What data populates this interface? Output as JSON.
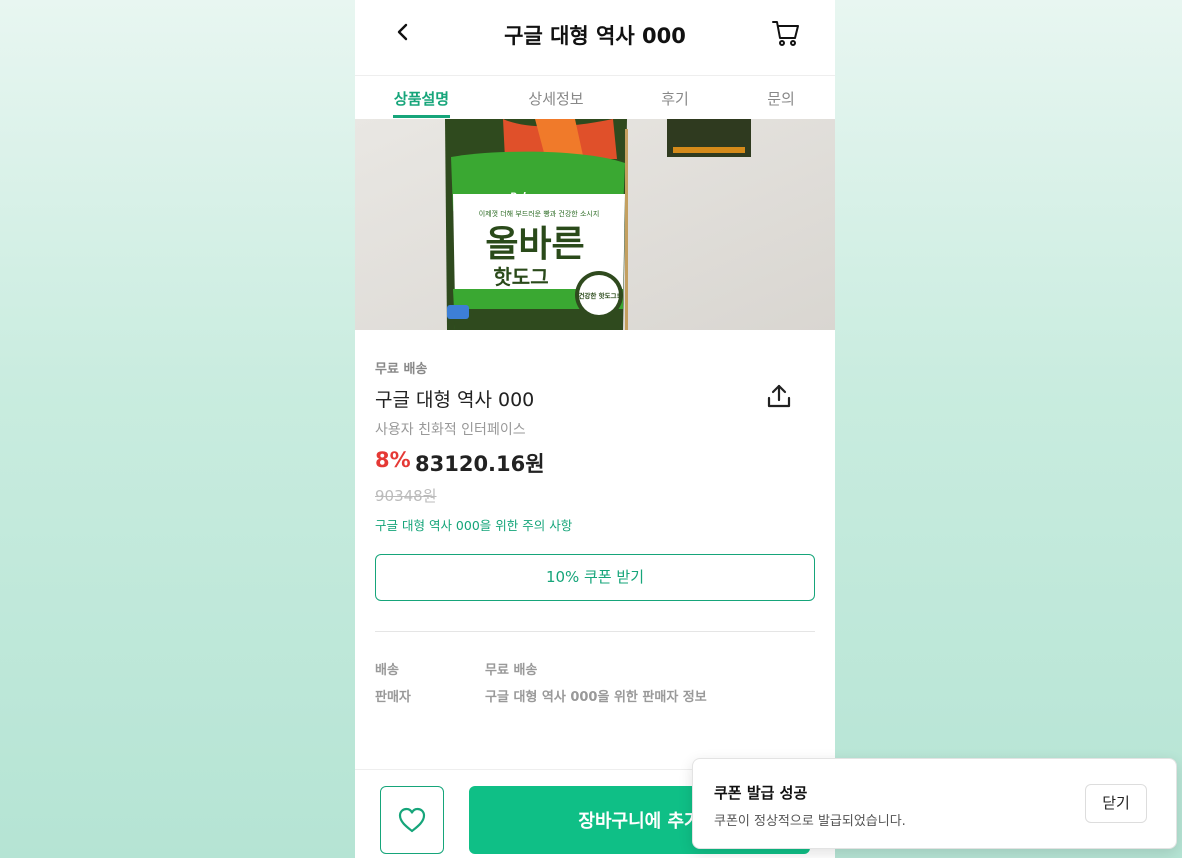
{
  "header": {
    "title": "구글 대형 역사 000"
  },
  "tabs": [
    {
      "label": "상품설명",
      "active": true
    },
    {
      "label": "상세정보",
      "active": false
    },
    {
      "label": "후기",
      "active": false
    },
    {
      "label": "문의",
      "active": false
    }
  ],
  "product_image": {
    "brand": "Pulmuone",
    "tagline": "이제껏 더해 부드러운 빵과 건강한 소시지",
    "title": "올바른",
    "subtitle": "핫도그",
    "badge": "건강한 핫도그!"
  },
  "product": {
    "shipping_tag": "무료 배송",
    "name": "구글 대형 역사 000",
    "subtitle": "사용자 친화적 인터페이스",
    "discount": "8%",
    "price": "83120.16원",
    "original_price": "90348원",
    "notice": "구글 대형 역사 000을 위한 주의 사항",
    "coupon_button": "10% 쿠폰 받기"
  },
  "details": [
    {
      "label": "배송",
      "value": "무료 배송"
    },
    {
      "label": "판매자",
      "value": "구글 대형 역사 000을 위한 판매자 정보"
    }
  ],
  "bottom_bar": {
    "add_to_cart": "장바구니에 추가"
  },
  "toast": {
    "title": "쿠폰 발급 성공",
    "message": "쿠폰이 정상적으로 발급되었습니다.",
    "close_label": "닫기"
  },
  "colors": {
    "accent": "#0fbf86",
    "accent_text": "#16a57a",
    "discount": "#e53935"
  }
}
